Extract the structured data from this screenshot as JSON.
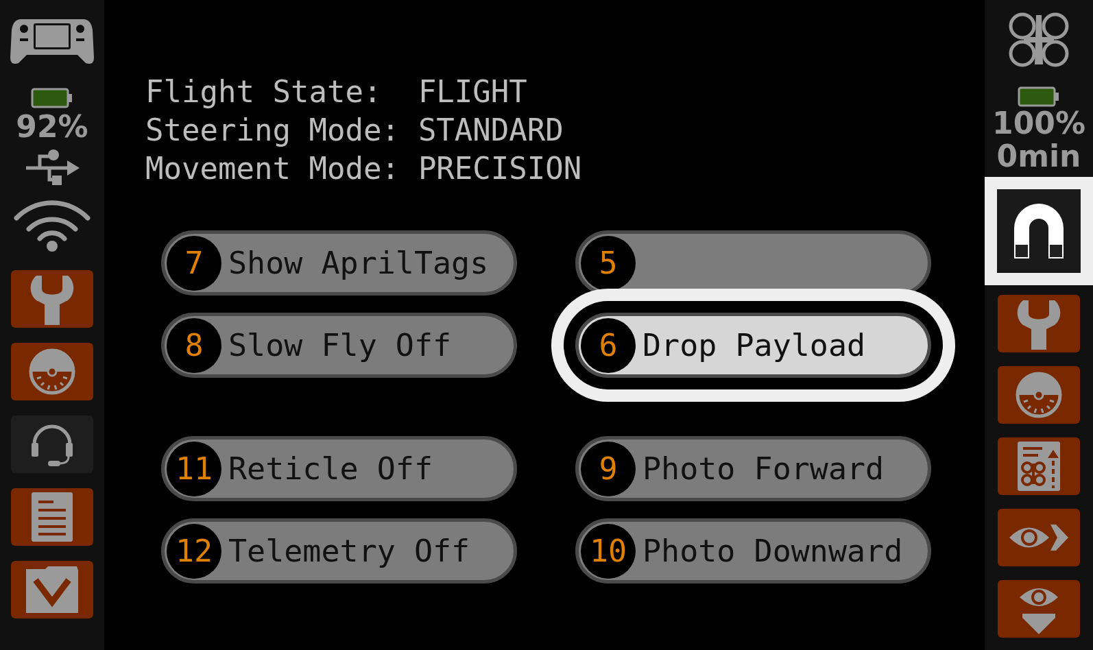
{
  "controller_status": {
    "battery_text": "92%"
  },
  "left_toolbar": [
    {
      "kind": "wrench",
      "disabled": false
    },
    {
      "kind": "gauge",
      "disabled": false
    },
    {
      "kind": "headset",
      "disabled": true
    },
    {
      "kind": "document",
      "disabled": false
    },
    {
      "kind": "folder-down",
      "disabled": false
    }
  ],
  "flight_info": [
    {
      "label": "Flight State:",
      "value": "FLIGHT"
    },
    {
      "label": "Steering Mode:",
      "value": "STANDARD"
    },
    {
      "label": "Movement Mode:",
      "value": "PRECISION"
    }
  ],
  "action_groups": [
    {
      "buttons": [
        {
          "number": "7",
          "label": "Show AprilTags",
          "selected": false
        },
        {
          "number": "5",
          "selected": false
        },
        {
          "number": "8",
          "label": "Slow Fly Off",
          "selected": false
        },
        {
          "number": "6",
          "label": "Drop Payload",
          "selected": true
        }
      ]
    },
    {
      "buttons": [
        {
          "number": "11",
          "label": "Reticle Off",
          "selected": false
        },
        {
          "number": "9",
          "label": "Photo Forward",
          "selected": false
        },
        {
          "number": "12",
          "label": "Telemetry Off",
          "selected": false
        },
        {
          "number": "10",
          "label": "Photo Downward",
          "selected": false
        }
      ]
    }
  ],
  "drone_status": {
    "battery_text": "100%",
    "flight_time": "0min"
  },
  "right_toolbar": [
    {
      "kind": "magnet",
      "selected": true
    },
    {
      "kind": "wrench",
      "selected": false
    },
    {
      "kind": "gauge",
      "selected": false
    },
    {
      "kind": "drone-checklist",
      "selected": false
    },
    {
      "kind": "eye-forward",
      "selected": false
    },
    {
      "kind": "eye-down",
      "selected": false
    }
  ]
}
